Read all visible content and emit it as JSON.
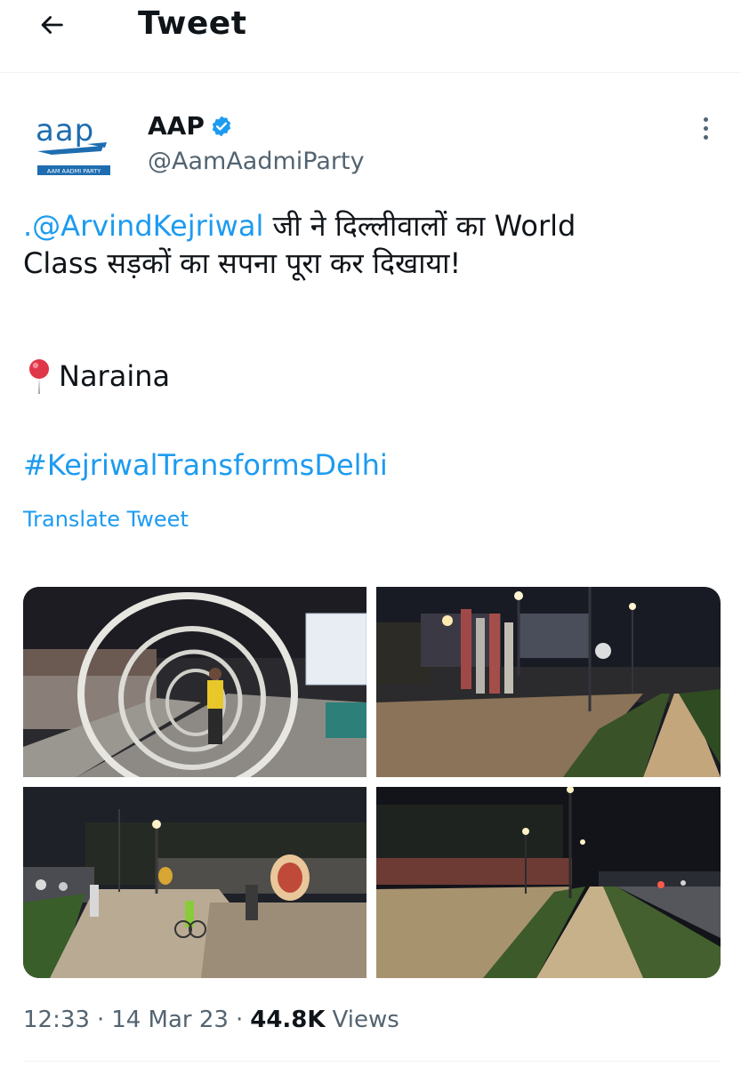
{
  "header": {
    "title": "Tweet",
    "back_icon": "arrow-left-icon"
  },
  "author": {
    "avatar_logo_text": "aap",
    "avatar_logo_subtext": "AAM AADMI PARTY",
    "name": "AAP",
    "verified_icon": "verified-badge-icon",
    "verified_color": "#1d9bf0",
    "handle": "@AamAadmiParty"
  },
  "tweet": {
    "mention": ".@ArvindKejriwal",
    "text_line1_rest": " जी ने दिल्लीवालों का World",
    "text_line2": "Class सड़कों का सपना पूरा कर दिखाया!",
    "location_icon": "pin-icon",
    "location": "Naraina",
    "hashtag": "#KejriwalTransformsDelhi",
    "translate_label": "Translate Tweet"
  },
  "media": {
    "count": 4
  },
  "meta": {
    "time": "12:33",
    "separator": "·",
    "date": "14 Mar 23",
    "views_count": "44.8K",
    "views_label": "Views"
  },
  "colors": {
    "link": "#1d9bf0",
    "secondary_text": "#536471",
    "primary_text": "#0f1419"
  }
}
